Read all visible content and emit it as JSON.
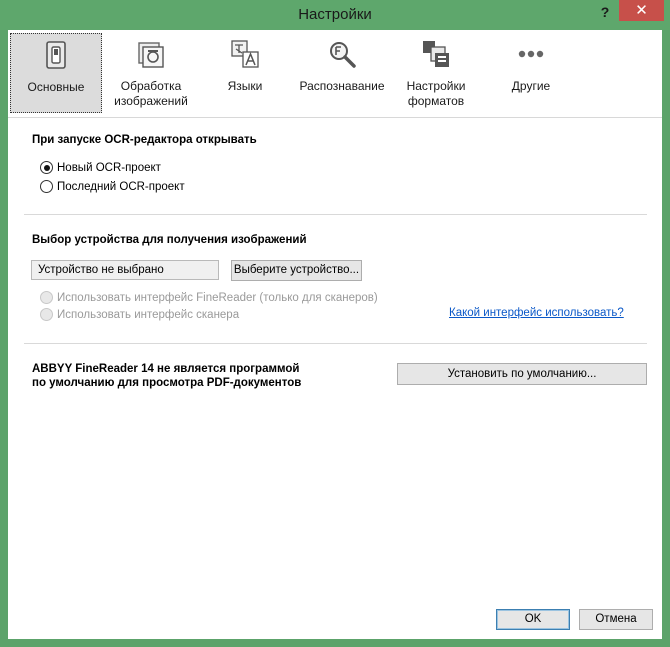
{
  "window": {
    "title": "Настройки",
    "help_glyph": "?",
    "close_glyph": "✕"
  },
  "tabs": [
    {
      "label": "Основные",
      "icon": "switch-icon",
      "active": true
    },
    {
      "label": "Обработка изображений",
      "icon": "image-processing-icon"
    },
    {
      "label": "Языки",
      "icon": "languages-icon"
    },
    {
      "label": "Распознавание",
      "icon": "recognition-icon"
    },
    {
      "label": "Настройки форматов",
      "icon": "formats-icon"
    },
    {
      "label": "Другие",
      "icon": "more-icon"
    }
  ],
  "startup": {
    "title": "При запуске OCR-редактора открывать",
    "options": [
      {
        "label": "Новый OCR-проект",
        "checked": true
      },
      {
        "label": "Последний OCR-проект",
        "checked": false
      }
    ]
  },
  "device": {
    "title": "Выбор устройства для получения изображений",
    "current_value": "Устройство не выбрано",
    "select_button": "Выберите устройство...",
    "options": [
      {
        "label": "Использовать интерфейс FineReader (только для сканеров)",
        "disabled": true
      },
      {
        "label": "Использовать интерфейс сканера",
        "disabled": true
      }
    ],
    "help_link": "Какой интерфейс использовать?"
  },
  "default_app": {
    "line1": "ABBYY FineReader 14 не является программой",
    "line2": "по умолчанию для просмотра PDF-документов",
    "button": "Установить по умолчанию..."
  },
  "footer": {
    "ok": "OK",
    "cancel": "Отмена"
  },
  "colors": {
    "titlebar": "#5ea76c",
    "close": "#c7504a",
    "link": "#0a58c8"
  }
}
